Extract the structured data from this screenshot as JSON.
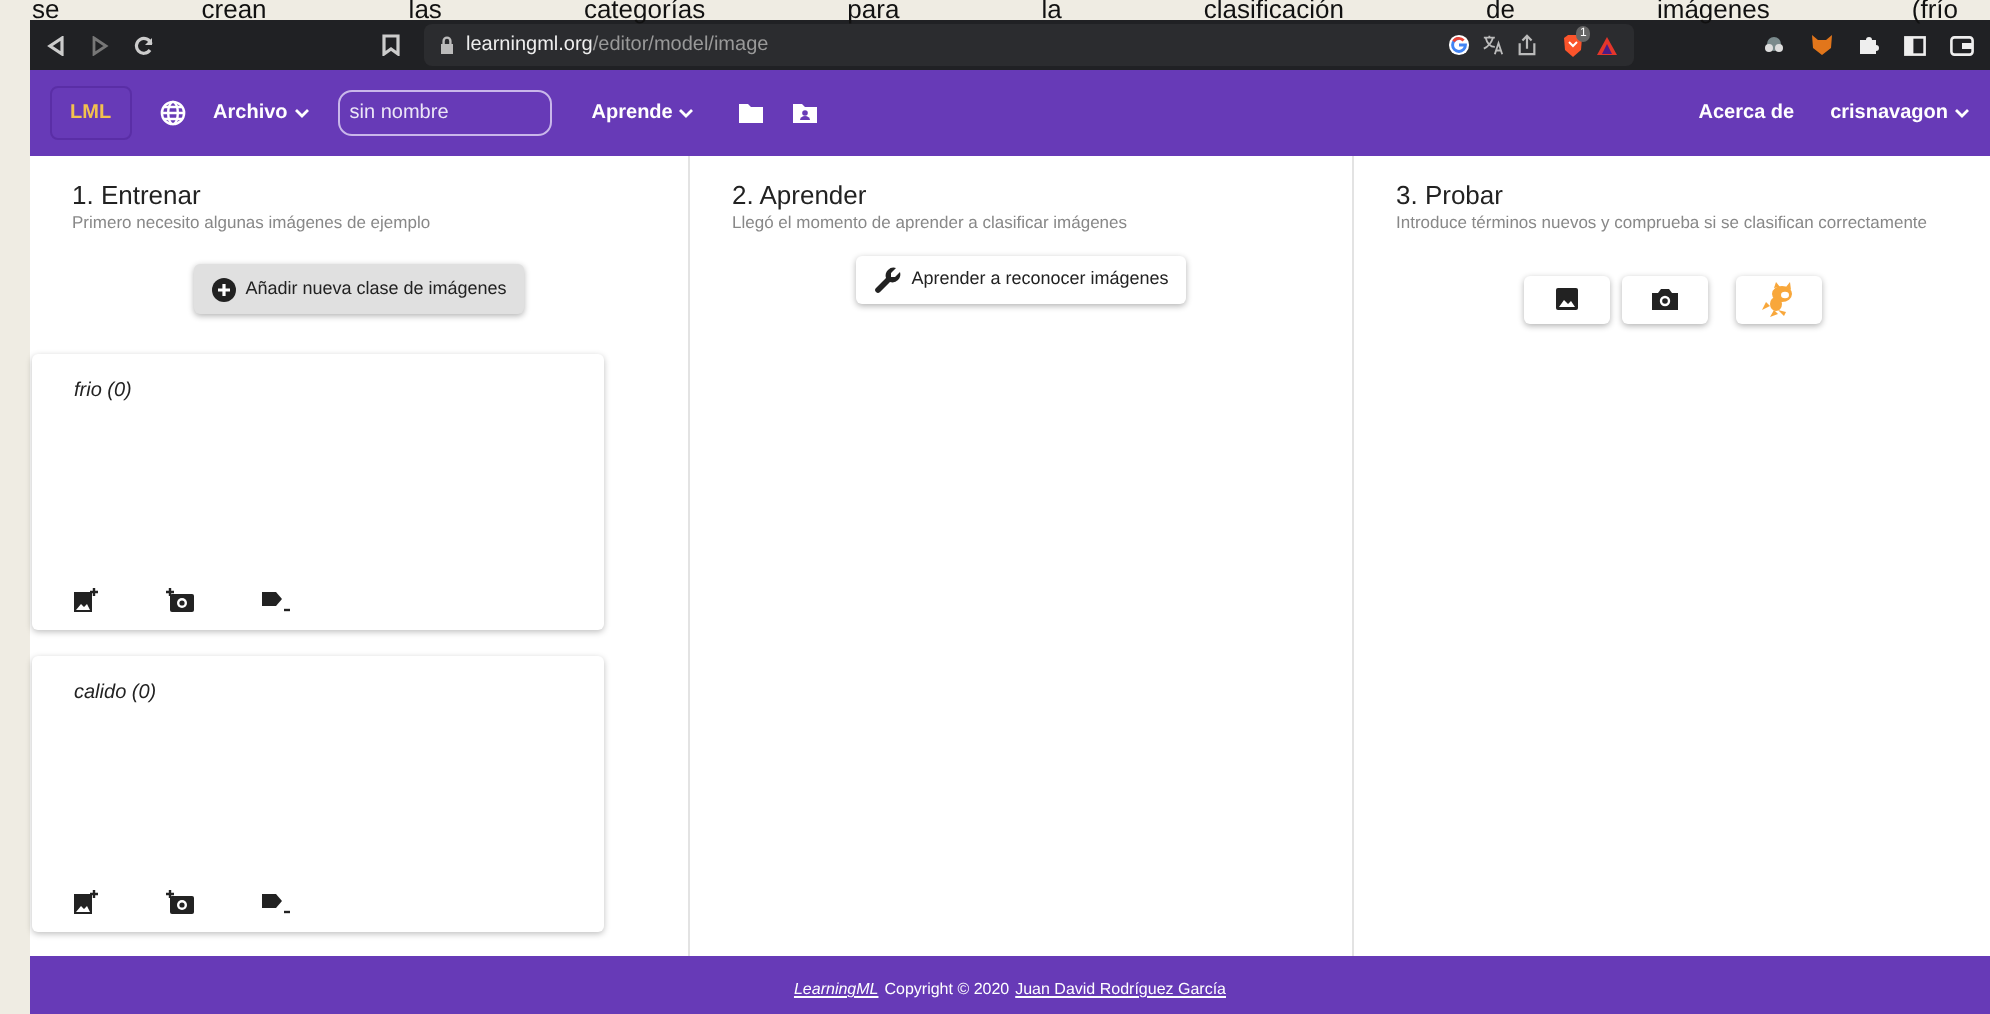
{
  "document_text": "se crean las categorías para la clasificación de imágenes (frío",
  "browser": {
    "url_host": "learningml.org",
    "url_path": "/editor/model/image",
    "shield_badge": "1"
  },
  "navbar": {
    "logo": "LML",
    "menus": [
      {
        "label": "Archivo"
      },
      {
        "label": "Aprende"
      }
    ],
    "name_field": {
      "placeholder": "sin nombre"
    },
    "about": "Acerca de",
    "user": "crisnavagon"
  },
  "train": {
    "title": "1. Entrenar",
    "subtitle": "Primero necesito algunas imágenes de ejemplo",
    "button": "Añadir nueva clase de imágenes",
    "classes": [
      {
        "label": "frio (0)"
      },
      {
        "label": "calido (0)"
      }
    ]
  },
  "learn": {
    "title": "2. Aprender",
    "subtitle": "Llegó el momento de aprender a clasificar imágenes",
    "button": "Aprender a reconocer imágenes"
  },
  "test": {
    "title": "3. Probar",
    "subtitle": "Introduce términos nuevos y comprueba si se clasifican correctamente"
  },
  "footer": {
    "site": "LearningML",
    "copyright": "Copyright © 2020",
    "author": "Juan David Rodríguez García"
  }
}
